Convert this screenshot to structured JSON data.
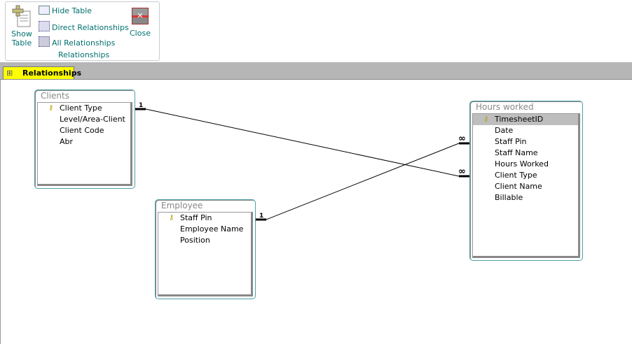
{
  "ribbon": {
    "show_table": "Show Table",
    "show_table_l1": "Show",
    "show_table_l2": "Table",
    "hide_table": "Hide Table",
    "direct_relationships": "Direct Relationships",
    "all_relationships": "All Relationships",
    "close": "Close",
    "group_label": "Relationships"
  },
  "tab": {
    "label": "Relationships"
  },
  "tables": {
    "clients": {
      "title": "Clients",
      "fields": [
        "Client Type",
        "Level/Area-Client",
        "Client Code",
        "Abr"
      ]
    },
    "employee": {
      "title": "Employee",
      "fields": [
        "Staff Pin",
        "Employee Name",
        "Position"
      ]
    },
    "hours": {
      "title": "Hours worked",
      "fields": [
        "TimesheetID",
        "Date",
        "Staff Pin",
        "Staff Name",
        "Hours Worked",
        "Client Type",
        "Client Name",
        "Billable"
      ]
    }
  },
  "relationships": {
    "one": "1",
    "many": "∞"
  }
}
